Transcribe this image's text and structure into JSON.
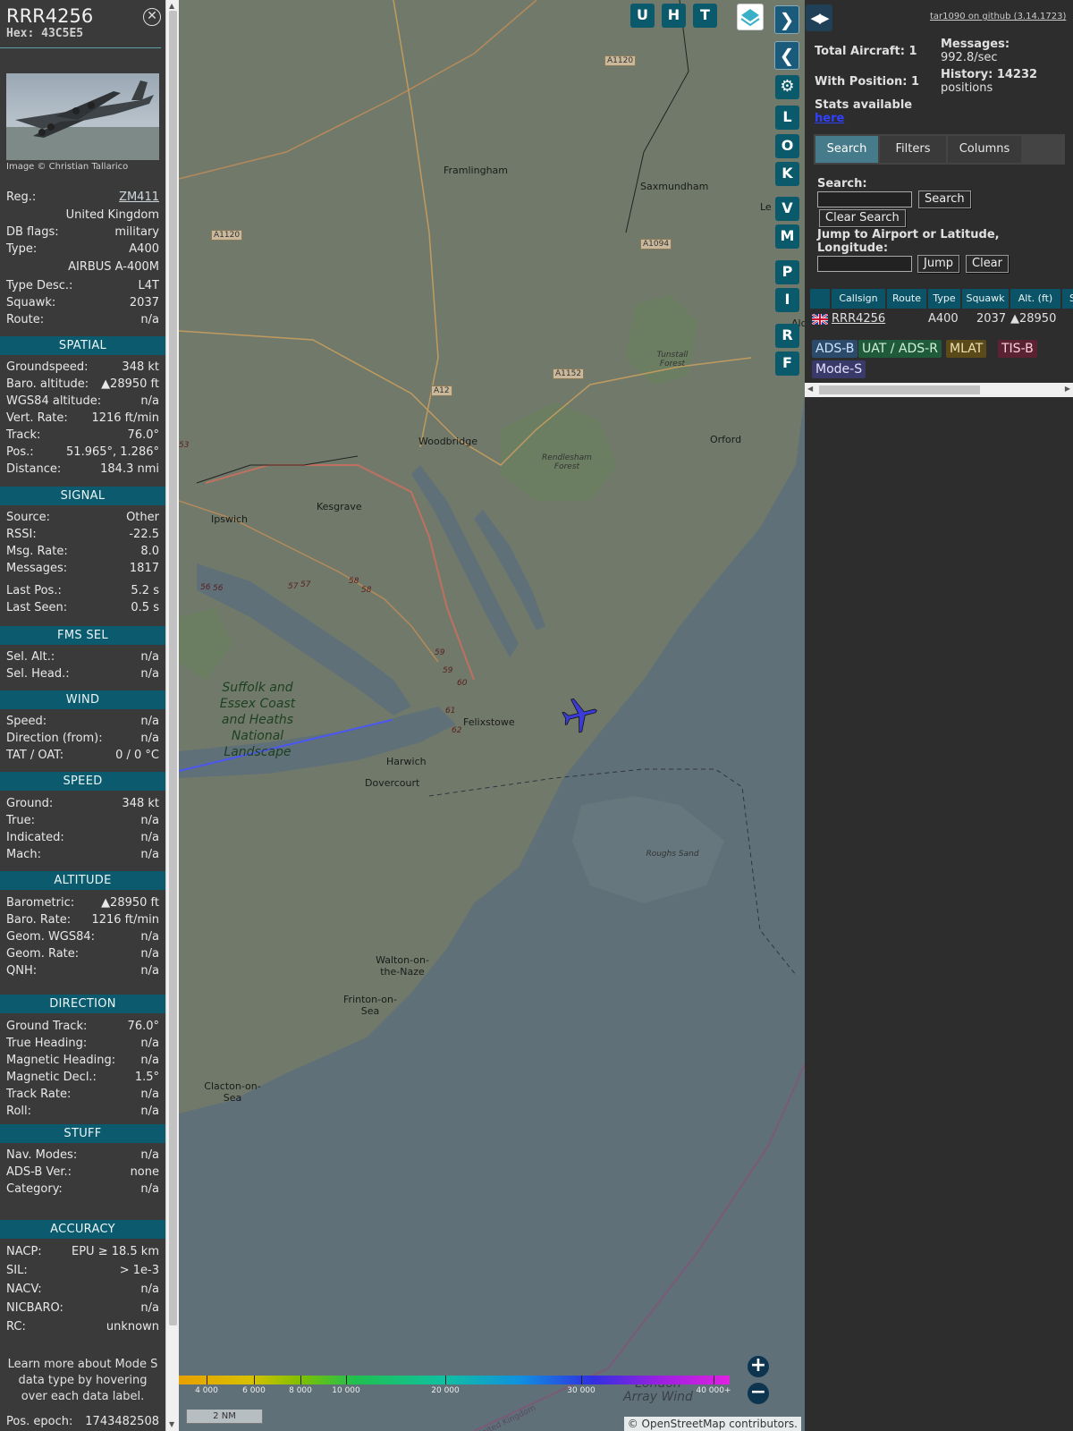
{
  "aircraft": {
    "callsign": "RRR4256",
    "hex": "Hex: 43C5E5",
    "image_credit": "Image © Christian Tallarico"
  },
  "info_rows_top": [
    {
      "label": "Reg.:",
      "value": "ZM411",
      "link": true
    },
    {
      "label": "",
      "value": "United Kingdom"
    },
    {
      "label": "DB flags:",
      "value": "military"
    },
    {
      "label": "Type:",
      "value": "A400"
    },
    {
      "label": "",
      "value": "AIRBUS A-400M"
    },
    {
      "label": "Type Desc.:",
      "value": "L4T"
    },
    {
      "label": "Squawk:",
      "value": "2037"
    },
    {
      "label": "Route:",
      "value": "n/a"
    }
  ],
  "sections": [
    {
      "title": "SPATIAL",
      "rows": [
        {
          "label": "Groundspeed:",
          "value": "348 kt"
        },
        {
          "label": "Baro. altitude:",
          "value": "▲28950 ft"
        },
        {
          "label": "WGS84 altitude:",
          "value": "n/a"
        },
        {
          "label": "Vert. Rate:",
          "value": "1216 ft/min"
        },
        {
          "label": "Track:",
          "value": "76.0°"
        },
        {
          "label": "Pos.:",
          "value": "51.965°, 1.286°"
        },
        {
          "label": "Distance:",
          "value": "184.3 nmi"
        }
      ]
    },
    {
      "title": "SIGNAL",
      "rows": [
        {
          "label": "Source:",
          "value": "Other"
        },
        {
          "label": "RSSI:",
          "value": "-22.5"
        },
        {
          "label": "Msg. Rate:",
          "value": "8.0"
        },
        {
          "label": "Messages:",
          "value": "1817"
        },
        {
          "label": "Last Pos.:",
          "value": "5.2 s"
        },
        {
          "label": "Last Seen:",
          "value": "0.5 s"
        }
      ]
    },
    {
      "title": "FMS SEL",
      "rows": [
        {
          "label": "Sel. Alt.:",
          "value": "n/a"
        },
        {
          "label": "Sel. Head.:",
          "value": "n/a"
        }
      ]
    },
    {
      "title": "WIND",
      "rows": [
        {
          "label": "Speed:",
          "value": "n/a"
        },
        {
          "label": "Direction (from):",
          "value": "n/a"
        },
        {
          "label": "TAT / OAT:",
          "value": "0 / 0 °C"
        }
      ]
    },
    {
      "title": "SPEED",
      "rows": [
        {
          "label": "Ground:",
          "value": "348 kt"
        },
        {
          "label": "True:",
          "value": "n/a"
        },
        {
          "label": "Indicated:",
          "value": "n/a"
        },
        {
          "label": "Mach:",
          "value": "n/a"
        }
      ]
    },
    {
      "title": "ALTITUDE",
      "rows": [
        {
          "label": "Barometric:",
          "value": "▲28950 ft"
        },
        {
          "label": "Baro. Rate:",
          "value": "1216 ft/min"
        },
        {
          "label": "Geom. WGS84:",
          "value": "n/a"
        },
        {
          "label": "Geom. Rate:",
          "value": "n/a"
        },
        {
          "label": "QNH:",
          "value": "n/a"
        }
      ]
    },
    {
      "title": "DIRECTION",
      "rows": [
        {
          "label": "Ground Track:",
          "value": "76.0°"
        },
        {
          "label": "True Heading:",
          "value": "n/a"
        },
        {
          "label": "Magnetic Heading:",
          "value": "n/a"
        },
        {
          "label": "Magnetic Decl.:",
          "value": "1.5°"
        },
        {
          "label": "Track Rate:",
          "value": "n/a"
        },
        {
          "label": "Roll:",
          "value": "n/a"
        }
      ]
    },
    {
      "title": "STUFF",
      "rows": [
        {
          "label": "Nav. Modes:",
          "value": "n/a"
        },
        {
          "label": "ADS-B Ver.:",
          "value": "none"
        },
        {
          "label": "Category:",
          "value": "n/a"
        }
      ]
    },
    {
      "title": "ACCURACY",
      "rows": [
        {
          "label": "NACP:",
          "value": "EPU ≥ 18.5 km"
        },
        {
          "label": "SIL:",
          "value": "> 1e-3"
        },
        {
          "label": "NACV:",
          "value": "n/a"
        },
        {
          "label": "NICBARO:",
          "value": "n/a"
        },
        {
          "label": "RC:",
          "value": "unknown"
        }
      ]
    }
  ],
  "learn_more": "Learn more about Mode S data type by hovering over each data label.",
  "pos_epoch": {
    "label": "Pos. epoch:",
    "value": "1743482508"
  },
  "map": {
    "top_buttons": [
      "U",
      "H",
      "T"
    ],
    "side_buttons": [
      "L",
      "O",
      "K",
      "V",
      "M",
      "P",
      "I",
      "R",
      "F"
    ],
    "place_labels": [
      "Framlingham",
      "Saxmundham",
      "Woodbridge",
      "Orford",
      "Kesgrave",
      "Ipswich",
      "Felixstowe",
      "Harwich",
      "Dovercourt",
      "Walton-on-the-Naze",
      "Frinton-on-Sea",
      "Clacton-on-Sea",
      "Rendlesham Forest",
      "Tunstall Forest",
      "Roughs Sand",
      "Suffolk and Essex Coast and Heaths National Landscape",
      "London Array Wind",
      "United Kingdom",
      "Ald",
      "Le"
    ],
    "road_labels": [
      "A1120",
      "A1120",
      "A1094",
      "A1152",
      "A12"
    ],
    "junction_labels": [
      "56",
      "56",
      "57",
      "57",
      "58",
      "58",
      "59",
      "59",
      "60",
      "61",
      "62",
      "53"
    ],
    "altitude_legend": [
      "4 000",
      "6 000",
      "8 000",
      "10 000",
      "20 000",
      "30 000",
      "40 000+"
    ],
    "scale": "2 NM",
    "attribution": "© OpenStreetMap contributors.",
    "zoom_in": "+",
    "zoom_out": "−",
    "colors": {
      "land": "#717a6a",
      "sea": "#5f7078",
      "track": "#4b57f2",
      "plane": "#3b3bd6"
    }
  },
  "sidebar": {
    "toggle": "◀▶",
    "github_link": "tar1090 on github (3.14.1723)",
    "total_aircraft": "Total Aircraft: 1",
    "with_position": "With Position: 1",
    "messages_label": "Messages:",
    "messages_value": "992.8/sec",
    "history_label": "History: 14232",
    "history_value": "positions",
    "stats_label": "Stats available",
    "stats_link": "here",
    "tabs": [
      "Search",
      "Filters",
      "Columns"
    ],
    "search_label": "Search:",
    "search_button": "Search",
    "clear_search_button": "Clear Search",
    "jump_label": "Jump to Airport or Latitude, Longitude:",
    "jump_button": "Jump",
    "clear_button": "Clear",
    "table_headers": [
      "",
      "Callsign",
      "Route",
      "Type",
      "Squawk",
      "Alt. (ft)",
      "Sp"
    ],
    "table_row": {
      "callsign": "RRR4256",
      "route": "",
      "type": "A400",
      "squawk": "2037",
      "alt": "▲28950"
    },
    "source_badges": [
      {
        "label": "ADS-B",
        "bg": "#2c4a6a",
        "fg": "#cfe3ff"
      },
      {
        "label": "UAT / ADS-R",
        "bg": "#1f5a3a",
        "fg": "#d0f0d8"
      },
      {
        "label": "MLAT",
        "bg": "#5a4a1a",
        "fg": "#f0e0b0"
      },
      {
        "label": "TIS-B",
        "bg": "#5a2233",
        "fg": "#ffd0dc"
      },
      {
        "label": "Mode-S",
        "bg": "#3a3a6a",
        "fg": "#e0e0ff"
      }
    ]
  }
}
